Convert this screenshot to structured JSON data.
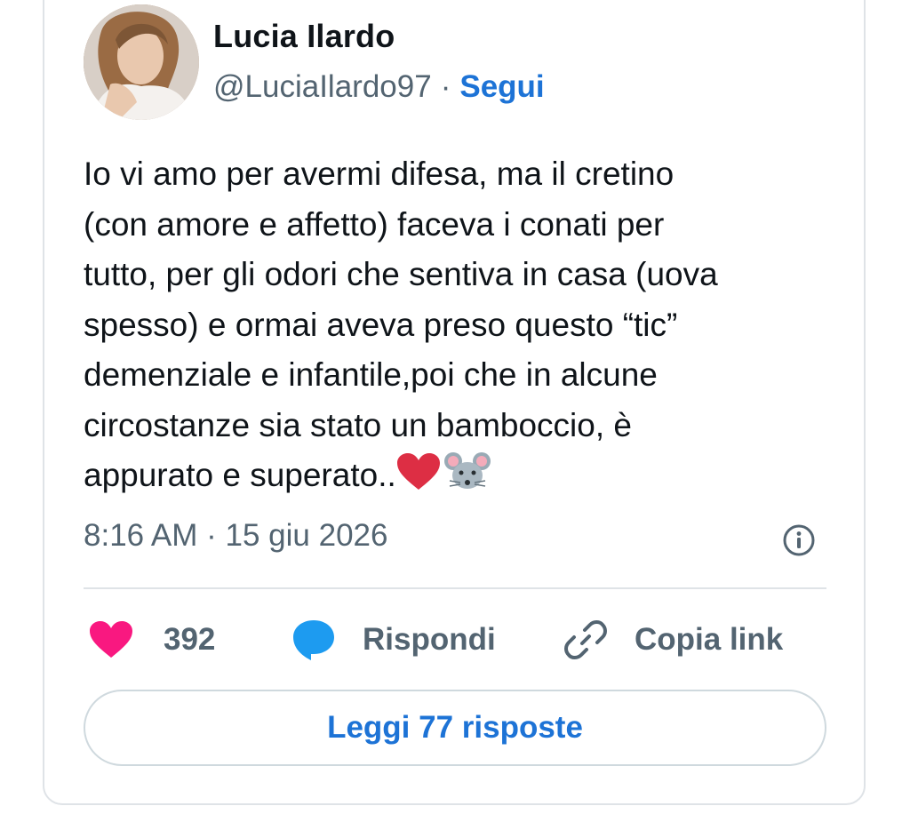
{
  "author": {
    "name": "Lucia Ilardo",
    "handle": "@LuciaIlardo97",
    "separator": "·",
    "follow_label": "Segui"
  },
  "tweet": {
    "text": "Io vi amo per avermi difesa, ma il cretino\n(con amore e affetto) faceva i conati per\ntutto, per gli odori che sentiva in casa (uova\nspesso) e ormai aveva preso questo “tic”\ndemenziale e infantile,poi che in alcune\ncircostanze sia stato un bamboccio, è\nappurato e superato..",
    "emojis": [
      "red-heart-emoji",
      "mouse-emoji"
    ],
    "timestamp": "8:16 AM · 15 giu 2026"
  },
  "actions": {
    "like_count": "392",
    "reply_label": "Rispondi",
    "copy_label": "Copia link"
  },
  "replies_button": "Leggi 77 risposte",
  "icons": {
    "like": "heart-icon",
    "reply": "speech-bubble-icon",
    "copy": "link-icon",
    "info": "info-icon"
  },
  "colors": {
    "accent": "#1d73d6",
    "like": "#f91880",
    "reply": "#1d9bf0",
    "muted": "#536471",
    "border": "#dfe3e7"
  }
}
